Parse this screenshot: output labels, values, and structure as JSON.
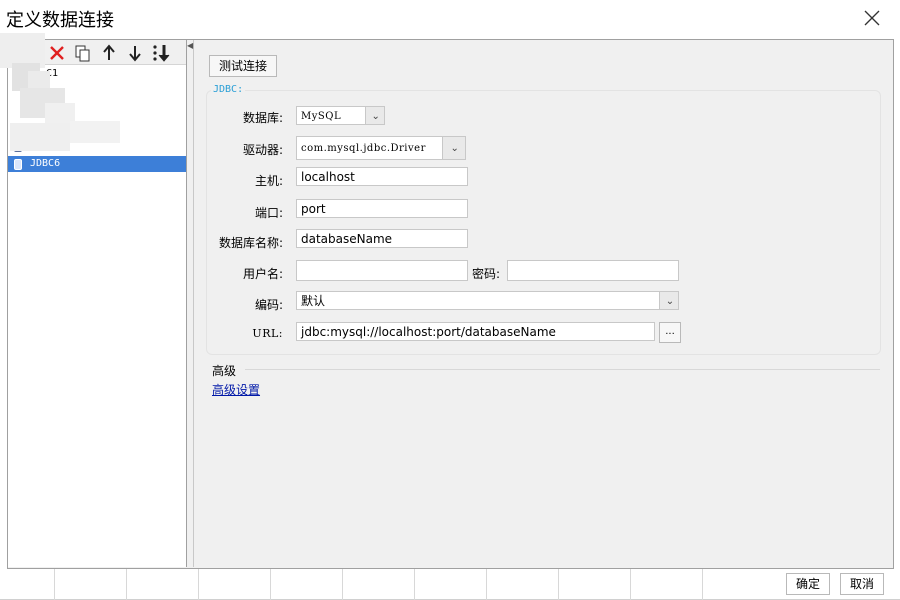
{
  "window": {
    "title": "定义数据连接"
  },
  "toolbar": {
    "icons": [
      "delete-icon",
      "copy-icon",
      "move-up-icon",
      "move-down-icon",
      "sort-icon"
    ]
  },
  "connections": {
    "items": [
      {
        "label": "C1",
        "selected": false
      },
      {
        "label": "e.",
        "selected": false
      },
      {
        "label": "JDBC6",
        "selected": true
      }
    ]
  },
  "main": {
    "test_button": "测试连接",
    "group_label": "JDBC:",
    "fields": {
      "database_label": "数据库:",
      "database_value": "MySQL",
      "driver_label": "驱动器:",
      "driver_value": "com.mysql.jdbc.Driver",
      "host_label": "主机:",
      "host_value": "localhost",
      "port_label": "端口:",
      "port_value": "port",
      "dbname_label": "数据库名称:",
      "dbname_value": "databaseName",
      "username_label": "用户名:",
      "username_value": "",
      "password_label": "密码:",
      "password_value": "",
      "encoding_label": "编码:",
      "encoding_value": "默认",
      "url_label": "URL:",
      "url_value": "jdbc:mysql://localhost:port/databaseName",
      "url_more": "..."
    },
    "advanced": {
      "heading": "高级",
      "link": "高级设置"
    }
  },
  "footer": {
    "ok": "确定",
    "cancel": "取消"
  },
  "colors": {
    "selection": "#3d7fd8",
    "link": "#0018a8",
    "delete": "#e02020",
    "group_label": "#2a9fd6"
  }
}
